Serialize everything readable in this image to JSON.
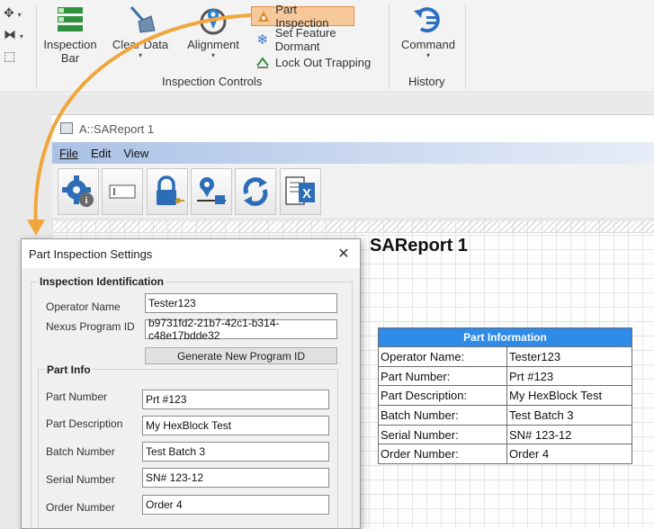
{
  "ribbon": {
    "left_tools": [
      "move-gizmo-icon",
      "mirror-icon",
      "select-box-icon"
    ],
    "inspection_bar_label_1": "Inspection",
    "inspection_bar_label_2": "Bar",
    "clear_data_label": "Clear Data",
    "alignment_label": "Alignment",
    "part_inspection_label": "Part Inspection",
    "set_feature_dormant_label": "Set Feature Dormant",
    "lock_out_trapping_label": "Lock Out Trapping",
    "inspection_controls_group": "Inspection Controls",
    "command_label": "Command",
    "history_group": "History",
    "accent_color": "#e0903e"
  },
  "report_window": {
    "title": "A::SAReport 1",
    "menu": [
      "File",
      "Edit",
      "View"
    ],
    "toolbar_icons": [
      "settings-info-icon",
      "label-field-icon",
      "lock-key-icon",
      "location-lock-icon",
      "refresh-icon",
      "excel-export-icon"
    ],
    "report_heading": "SAReport 1"
  },
  "part_information_table": {
    "header": "Part Information",
    "header_color": "#2e8be8",
    "rows": [
      [
        "Operator Name:",
        "Tester123"
      ],
      [
        "Part Number:",
        "Prt #123"
      ],
      [
        "Part Description:",
        "My HexBlock Test"
      ],
      [
        "Batch Number:",
        "Test Batch 3"
      ],
      [
        "Serial Number:",
        "SN# 123-12"
      ],
      [
        "Order Number:",
        "Order 4"
      ]
    ]
  },
  "dialog": {
    "title": "Part Inspection Settings",
    "identification_header": "Inspection Identification",
    "operator_label": "Operator Name",
    "operator_value": "Tester123",
    "program_id_label": "Nexus Program ID",
    "program_id_value": "b9731fd2-21b7-42c1-b314-c48e17bdde32",
    "generate_button": "Generate New Program ID",
    "part_info_header": "Part Info",
    "fields": [
      {
        "label": "Part Number",
        "value": "Prt #123"
      },
      {
        "label": "Part Description",
        "value": "My HexBlock Test"
      },
      {
        "label": "Batch Number",
        "value": "Test Batch 3"
      },
      {
        "label": "Serial Number",
        "value": "SN# 123-12"
      },
      {
        "label": "Order Number",
        "value": "Order 4"
      }
    ]
  }
}
